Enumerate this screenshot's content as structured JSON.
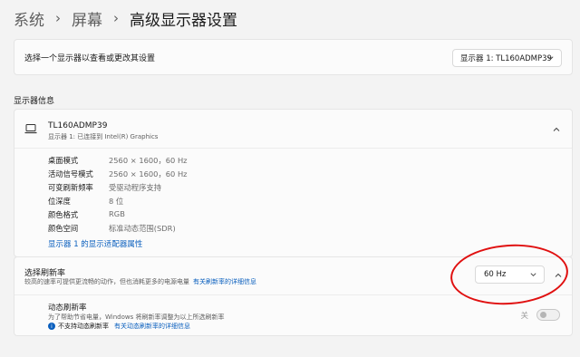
{
  "breadcrumb": {
    "items": [
      "系统",
      "屏幕",
      "高级显示器设置"
    ],
    "separator": "›"
  },
  "monitor_select": {
    "label": "选择一个显示器以查看或更改其设置",
    "value": "显示器 1: TL160ADMP39"
  },
  "display_info": {
    "section_title": "显示器信息",
    "monitor_name": "TL160ADMP39",
    "monitor_subtitle": "显示器 1: 已连接到 Intel(R) Graphics",
    "properties": [
      {
        "key": "桌面模式",
        "value": "2560 × 1600，60 Hz"
      },
      {
        "key": "活动信号模式",
        "value": "2560 × 1600，60 Hz"
      },
      {
        "key": "可变刷新频率",
        "value": "受驱动程序支持"
      },
      {
        "key": "位深度",
        "value": "8 位"
      },
      {
        "key": "颜色格式",
        "value": "RGB"
      },
      {
        "key": "颜色空间",
        "value": "标准动态范围(SDR)"
      }
    ],
    "adapter_link": "显示器 1 的显示适配器属性"
  },
  "refresh_rate": {
    "title": "选择刷新率",
    "description": "较高的速率可提供更流畅的动作，但也消耗更多的电源电量",
    "details_link": "有关刷新率的详细信息",
    "selected": "60 Hz"
  },
  "dynamic_refresh": {
    "title": "动态刷新率",
    "description": "为了帮助节省电量，Windows 将刷新率调整为以上所选刷新率",
    "note": "不支持动态刷新率",
    "note_link": "有关动态刷新率的详细信息",
    "toggle_label": "关",
    "toggle_on": false
  },
  "colors": {
    "accent_link": "#0a5fbe",
    "highlight_circle": "#e01010"
  },
  "icons": [
    "chevron-right-icon",
    "chevron-down-icon",
    "chevron-up-icon",
    "laptop-icon",
    "info-icon"
  ]
}
